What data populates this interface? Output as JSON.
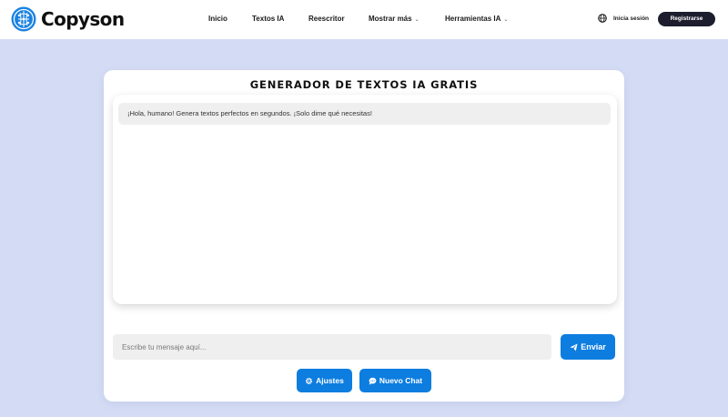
{
  "brand": {
    "name": "Copyson",
    "color": "#1a82e0",
    "logo_icon": "brain-circuit-icon"
  },
  "nav": {
    "items": [
      {
        "label": "Inicio",
        "dropdown": false
      },
      {
        "label": "Textos IA",
        "dropdown": false
      },
      {
        "label": "Reescritor",
        "dropdown": false
      },
      {
        "label": "Mostrar más",
        "dropdown": true
      },
      {
        "label": "Herramientas IA",
        "dropdown": true
      }
    ],
    "language_icon": "globe-icon",
    "login_label": "Inicia sesión",
    "register_label": "Registrarse"
  },
  "main": {
    "title": "GENERADOR DE TEXTOS IA GRATIS",
    "messages": [
      {
        "role": "bot",
        "text": "¡Hola, humano! Genera textos perfectos en segundos. ¡Solo dime qué necesitas!"
      }
    ],
    "input": {
      "placeholder": "Escribe tu mensaje aquí...",
      "value": ""
    },
    "send_label": "Enviar",
    "send_icon": "paper-plane-icon",
    "settings_label": "Ajustes",
    "settings_icon": "gear-icon",
    "new_chat_label": "Nuevo Chat",
    "new_chat_icon": "chat-bubble-icon"
  },
  "colors": {
    "page_bg": "#d4dcf5",
    "accent": "#0d7ddf",
    "dark_button": "#1c1e2e"
  }
}
